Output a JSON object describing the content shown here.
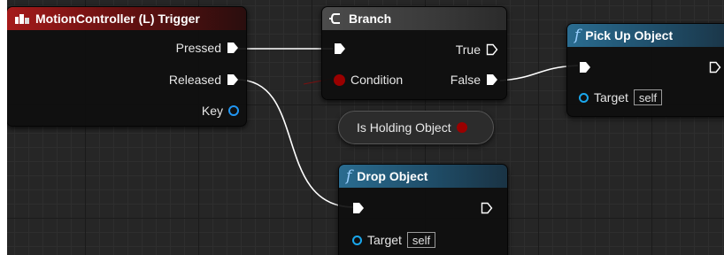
{
  "graph": {
    "event_node": {
      "title": "MotionController (L) Trigger",
      "pins": [
        {
          "label": "Pressed"
        },
        {
          "label": "Released"
        },
        {
          "label": "Key"
        }
      ]
    },
    "branch_node": {
      "title": "Branch",
      "inputs": [
        {
          "label": ""
        },
        {
          "label": "Condition"
        }
      ],
      "outputs": [
        {
          "label": "True"
        },
        {
          "label": "False"
        }
      ]
    },
    "pickup_node": {
      "title": "Pick Up Object",
      "target_label": "Target",
      "target_value": "self"
    },
    "getter_node": {
      "label": "Is Holding Object"
    },
    "drop_node": {
      "title": "Drop Object",
      "target_label": "Target",
      "target_value": "self"
    }
  },
  "colors": {
    "event_header": "#a51a1a",
    "function_header": "#2a6c90",
    "branch_header": "#4c4c4c",
    "bool_pin": "#9a0000",
    "object_pin": "#1aa7ec",
    "exec_wire": "#ffffff"
  },
  "icons": {
    "event": "controller-icon",
    "branch": "branch-icon",
    "function": "function-f-icon"
  }
}
